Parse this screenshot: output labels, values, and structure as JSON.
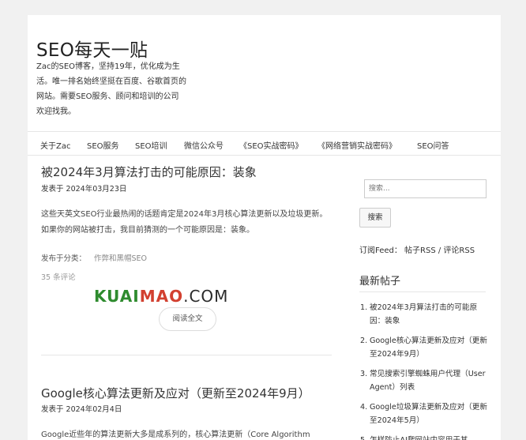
{
  "site": {
    "title": "SEO每天一贴",
    "description": "Zac的SEO博客，坚持19年，优化成为生活。唯一排名始终坚挺在百度、谷歌首页的网站。需要SEO服务、顾问和培训的公司欢迎找我。"
  },
  "nav": {
    "items": [
      {
        "label": "关于Zac"
      },
      {
        "label": "SEO服务"
      },
      {
        "label": "SEO培训"
      },
      {
        "label": "微信公众号"
      },
      {
        "label": "《SEO实战密码》"
      },
      {
        "label": "《网络营销实战密码》"
      },
      {
        "label": "SEO问答"
      }
    ]
  },
  "posts": [
    {
      "title": "被2024年3月算法打击的可能原因：装象",
      "date": "发表于 2024年03月23日",
      "excerpt": "这些天英文SEO行业最热闹的话题肯定是2024年3月核心算法更新以及垃圾更新。如果你的网站被打击，我目前猜测的一个可能原因是：装象。",
      "category_label": "发布于分类：",
      "category": "作弊和黑帽SEO",
      "comments": "35 条评论",
      "read_more": "阅读全文"
    },
    {
      "title": "Google核心算法更新及应对（更新至2024年9月）",
      "date": "发表于 2024年02月4日",
      "excerpt": "Google近些年的算法更新大多是成系列的，核心算法更新（Core Algorithm"
    }
  ],
  "watermark": {
    "part1": "KUAI",
    "part2": "MAO",
    "part3": ".COM"
  },
  "sidebar": {
    "search_placeholder": "搜索...",
    "search_button": "搜索",
    "feed_label": "订阅Feed：",
    "feed_posts": "帖子RSS",
    "feed_sep": " / ",
    "feed_comments": "评论RSS",
    "recent_title": "最新帖子",
    "recent": [
      {
        "num": "1.",
        "label": "被2024年3月算法打击的可能原因：装象"
      },
      {
        "num": "2.",
        "label": "Google核心算法更新及应对（更新至2024年9月）"
      },
      {
        "num": "3.",
        "label": "常见搜索引擎蜘蛛用户代理（User Agent）列表"
      },
      {
        "num": "4.",
        "label": "Google垃圾算法更新及应对（更新至2024年5月）"
      },
      {
        "num": "5.",
        "label": "怎样防止AI爬网站内容用于其"
      }
    ]
  },
  "colors": {
    "background": "#f1f1f1",
    "card": "#ffffff",
    "watermark_green": "#2e8b2e",
    "watermark_red": "#d24030"
  }
}
